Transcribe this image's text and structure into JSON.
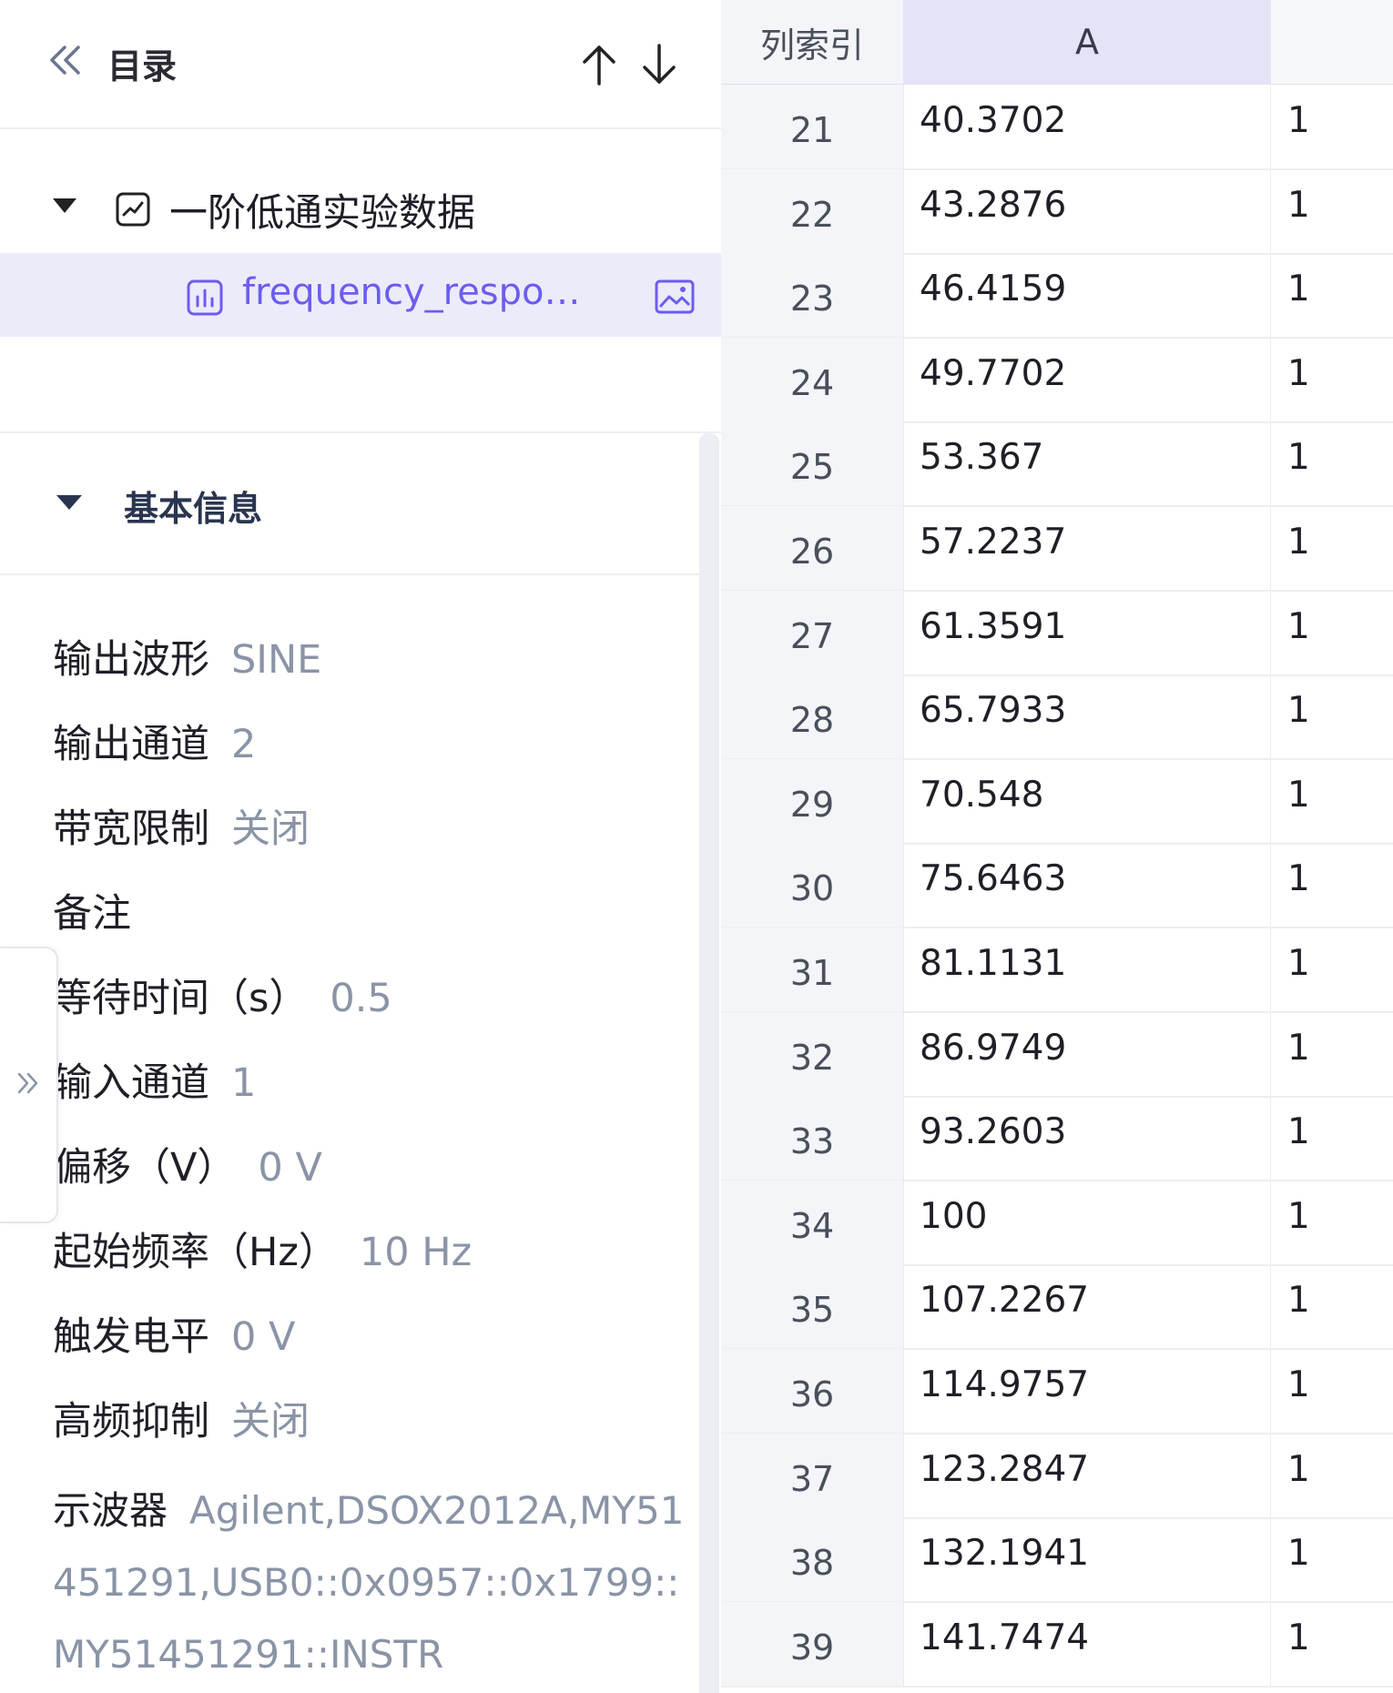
{
  "toc": {
    "title": "目录",
    "tree": {
      "root_label": "一阶低通实验数据",
      "child_label": "frequency_respo…"
    }
  },
  "info": {
    "section_title": "基本信息",
    "props": [
      {
        "key": "输出波形",
        "value": "SINE"
      },
      {
        "key": "输出通道",
        "value": "2"
      },
      {
        "key": "带宽限制",
        "value": "关闭"
      },
      {
        "key": "备注",
        "value": ""
      },
      {
        "key": "等待时间（s）",
        "value": "0.5"
      },
      {
        "key": "输入通道",
        "value": "1"
      },
      {
        "key": "偏移（V）",
        "value": "0 V"
      },
      {
        "key": "起始频率（Hz）",
        "value": "10 Hz"
      },
      {
        "key": "触发电平",
        "value": "0 V"
      },
      {
        "key": "高频抑制",
        "value": "关闭"
      }
    ],
    "scope": {
      "key": "示波器",
      "value": "Agilent,DSOX2012A,MY51451291,USB0::0x0957::0x1799::MY51451291::INSTR"
    }
  },
  "table": {
    "headers": {
      "index": "列索引",
      "a": "A",
      "b": ""
    },
    "rows": [
      {
        "idx": "21",
        "a": "40.3702",
        "b": "1"
      },
      {
        "idx": "22",
        "a": "43.2876",
        "b": "1"
      },
      {
        "idx": "23",
        "a": "46.4159",
        "b": "1"
      },
      {
        "idx": "24",
        "a": "49.7702",
        "b": "1"
      },
      {
        "idx": "25",
        "a": "53.367",
        "b": "1"
      },
      {
        "idx": "26",
        "a": "57.2237",
        "b": "1"
      },
      {
        "idx": "27",
        "a": "61.3591",
        "b": "1"
      },
      {
        "idx": "28",
        "a": "65.7933",
        "b": "1"
      },
      {
        "idx": "29",
        "a": "70.548",
        "b": "1"
      },
      {
        "idx": "30",
        "a": "75.6463",
        "b": "1"
      },
      {
        "idx": "31",
        "a": "81.1131",
        "b": "1"
      },
      {
        "idx": "32",
        "a": "86.9749",
        "b": "1"
      },
      {
        "idx": "33",
        "a": "93.2603",
        "b": "1"
      },
      {
        "idx": "34",
        "a": "100",
        "b": "1"
      },
      {
        "idx": "35",
        "a": "107.2267",
        "b": "1"
      },
      {
        "idx": "36",
        "a": "114.9757",
        "b": "1"
      },
      {
        "idx": "37",
        "a": "123.2847",
        "b": "1"
      },
      {
        "idx": "38",
        "a": "132.1941",
        "b": "1"
      },
      {
        "idx": "39",
        "a": "141.7474",
        "b": "1"
      }
    ]
  },
  "icons": {
    "collapse": "double-chevron-left-icon",
    "up": "arrow-up-icon",
    "down": "arrow-down-icon",
    "root": "line-chart-icon",
    "child": "bar-chart-icon",
    "image": "image-icon",
    "expand": "double-chevron-right-icon"
  },
  "colors": {
    "accent": "#6c5cf0",
    "selected_bg": "#ecebfa",
    "header_a_bg": "#e4e3f8"
  }
}
